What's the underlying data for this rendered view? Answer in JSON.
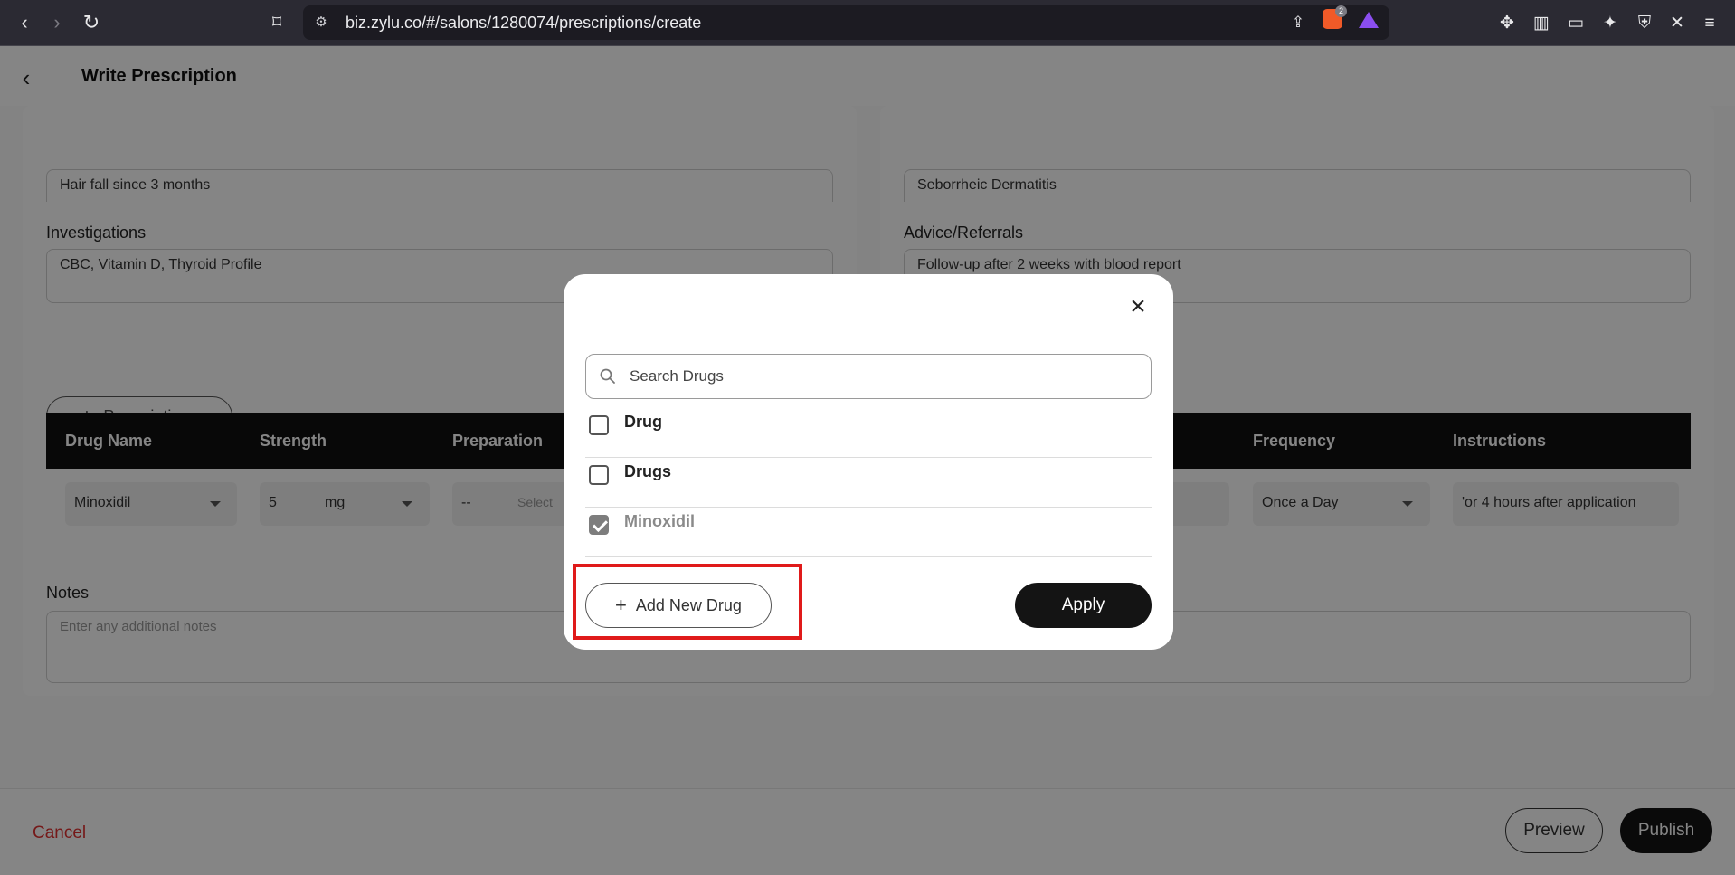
{
  "browser": {
    "url": "biz.zylu.co/#/salons/1280074/prescriptions/create",
    "extension_count": "2"
  },
  "header": {
    "title": "Write Prescription"
  },
  "form": {
    "complaint_value": "Hair fall since 3 months",
    "diagnosis_value": "Seborrheic Dermatitis",
    "investigations_label": "Investigations",
    "investigations_value": "CBC, Vitamin D, Thyroid Profile",
    "advice_label": "Advice/Referrals",
    "advice_value": "Follow-up after 2 weeks with blood report",
    "prescriptions_button": "Prescriptions",
    "notes_label": "Notes",
    "notes_placeholder": "Enter any additional notes"
  },
  "table": {
    "headers": [
      "Drug Name",
      "Strength",
      "Preparation",
      "Frequency",
      "Instructions"
    ],
    "row": {
      "drug_name": "Minoxidil",
      "strength_value": "5",
      "strength_unit": "mg",
      "preparation_value": "--",
      "preparation_placeholder": "Select",
      "frequency": "Once a Day",
      "instructions": "'or 4 hours after application"
    }
  },
  "footer": {
    "cancel": "Cancel",
    "preview": "Preview",
    "publish": "Publish"
  },
  "modal": {
    "search_placeholder": "Search Drugs",
    "drugs": [
      {
        "name": "Drug",
        "checked": false
      },
      {
        "name": "Drugs",
        "checked": false
      },
      {
        "name": "Minoxidil",
        "checked": true
      }
    ],
    "add_new_drug": "Add New Drug",
    "apply": "Apply"
  },
  "colors": {
    "accent": "#141414",
    "highlight": "#e01a1a",
    "cancel": "#e03131"
  }
}
